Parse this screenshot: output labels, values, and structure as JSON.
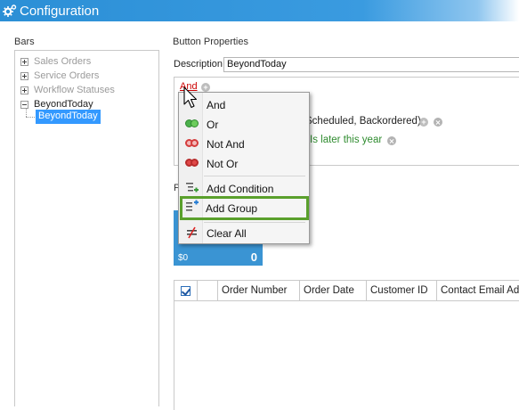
{
  "window": {
    "title": "Configuration",
    "icon": "gear-icon"
  },
  "bars": {
    "label": "Bars",
    "items": [
      {
        "label": "Sales Orders",
        "expander": "plus",
        "muted": true
      },
      {
        "label": "Service Orders",
        "expander": "plus",
        "muted": true
      },
      {
        "label": "Workflow Statuses",
        "expander": "plus",
        "muted": true
      },
      {
        "label": "BeyondToday",
        "expander": "minus",
        "muted": false
      }
    ],
    "selected_child": "BeyondToday"
  },
  "button_properties": {
    "label": "Button Properties",
    "description_label": "Description",
    "description_value": "BeyondToday"
  },
  "filter": {
    "root_operator": "And",
    "condition1_text": "Scheduled, Backordered)",
    "condition2_text": "Is later this year"
  },
  "preview": {
    "label_letter": "P",
    "tile_amount": "$0",
    "tile_count": "0",
    "tile_color": "#3a94d3"
  },
  "grid": {
    "columns": [
      "Order Number",
      "Order Date",
      "Customer ID",
      "Contact Email Add"
    ]
  },
  "context_menu": {
    "items": [
      {
        "label": "And",
        "icon": "none"
      },
      {
        "label": "Or",
        "icon": "green-rings-icon"
      },
      {
        "label": "Not And",
        "icon": "red-rings-icon"
      },
      {
        "label": "Not Or",
        "icon": "red-rings-icon"
      },
      {
        "label": "Add Condition",
        "icon": "add-condition-icon"
      },
      {
        "label": "Add Group",
        "icon": "add-group-icon"
      },
      {
        "label": "Clear All",
        "icon": "not-equal-icon"
      }
    ],
    "highlighted": "Add Group",
    "highlight_color": "#5aa02c"
  }
}
